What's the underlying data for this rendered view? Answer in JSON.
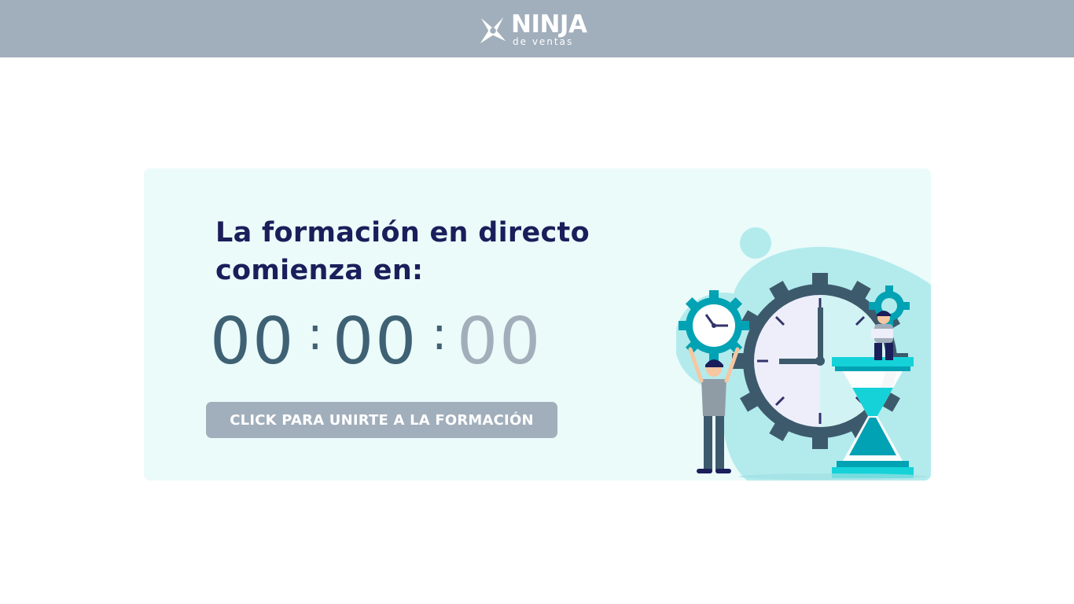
{
  "header": {
    "logo": {
      "brand": "NINJA",
      "subtitle": "de ventas"
    }
  },
  "card": {
    "heading": "La formación en directo comienza en:",
    "countdown": {
      "hours": "00",
      "minutes": "00",
      "seconds": "00",
      "separator": ":"
    },
    "join_button_label": "CLICK PARA UNIRTE A LA FORMACIÓN",
    "illustration_icon": "clock-gears-hourglass-illustration"
  },
  "colors": {
    "header_bg": "#a1aebb",
    "card_bg": "#ebfbfa",
    "heading_text": "#1a1e5a",
    "countdown_active": "#3f6174",
    "countdown_muted": "#a2afbb",
    "button_bg": "#a1aebb",
    "teal_accent": "#27c7cf"
  }
}
